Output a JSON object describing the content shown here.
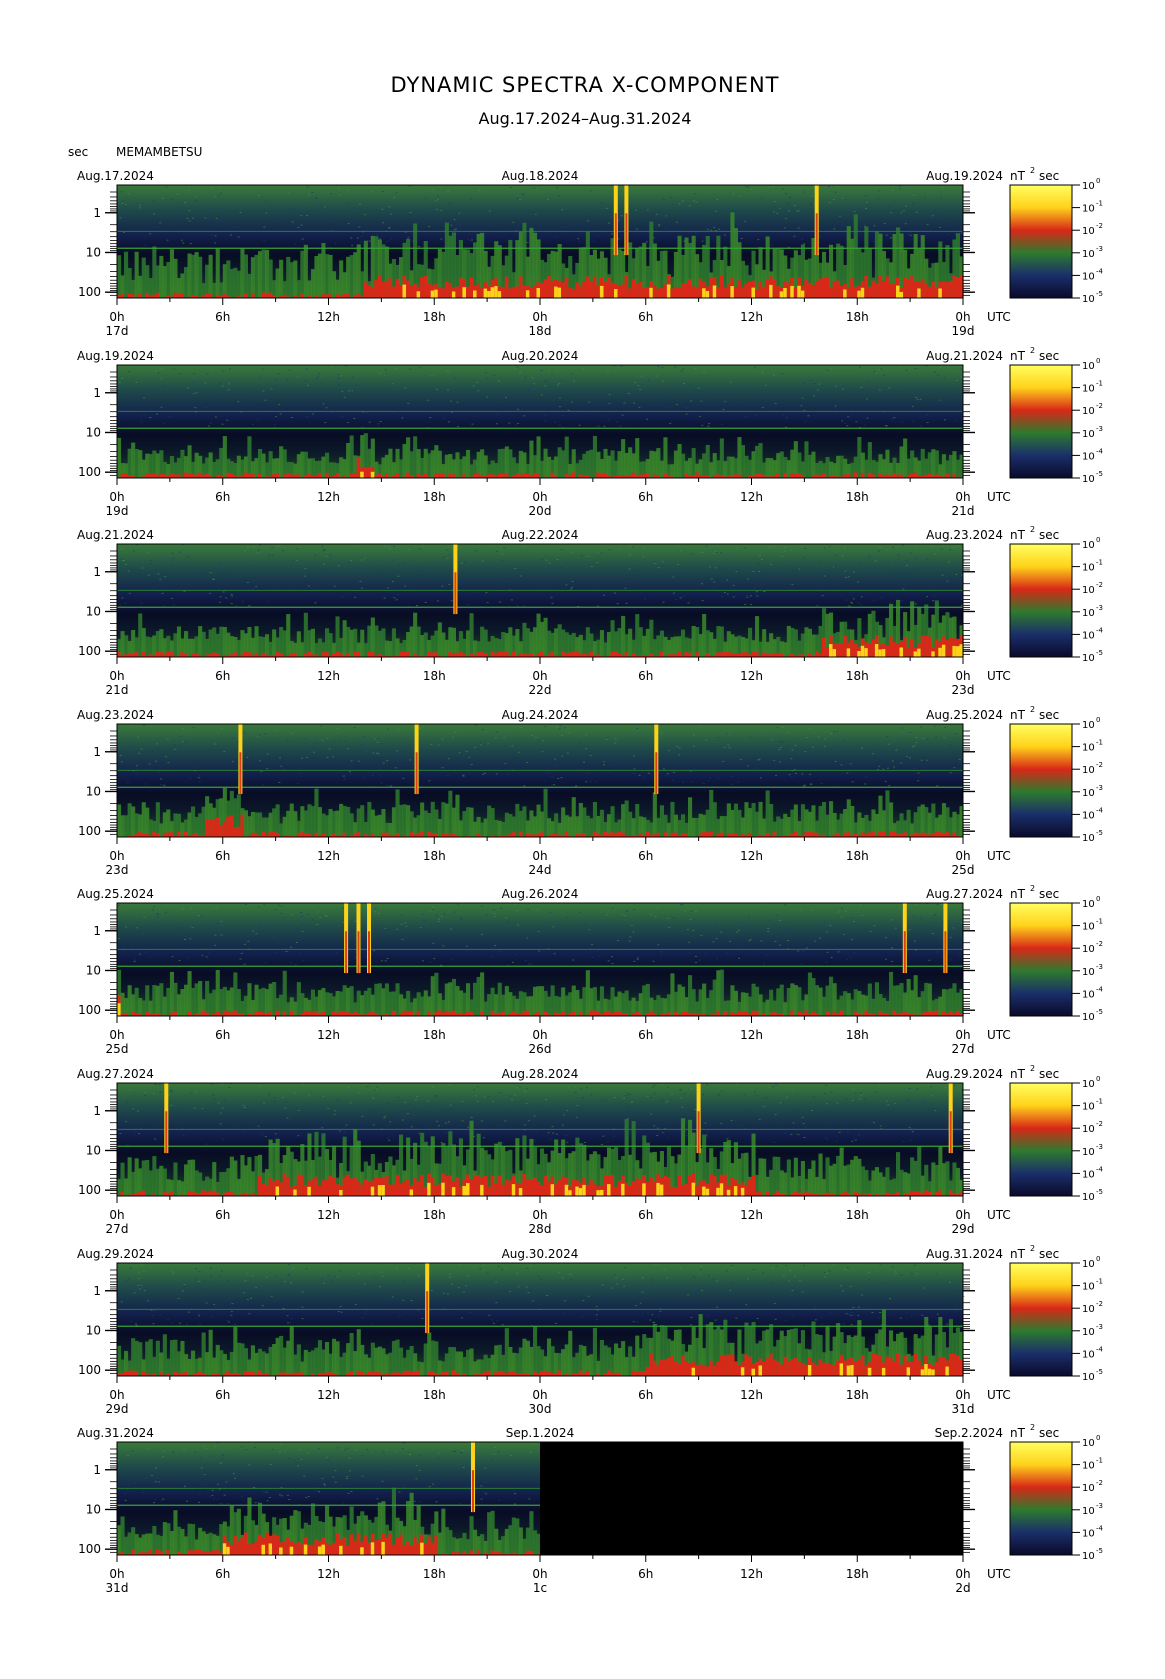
{
  "title": "DYNAMIC SPECTRA X-COMPONENT",
  "subtitle": "Aug.17.2024–Aug.31.2024",
  "unit_sec": "sec",
  "station": "MEMAMBETSU",
  "colorbar_unit": "nT",
  "colorbar_unit_exp": "2",
  "colorbar_unit_sec": "sec",
  "utc_label": "UTC",
  "colormap": [
    "#0a0a2a",
    "#1a2f6a",
    "#2e7a2e",
    "#d82818",
    "#ffd21a",
    "#ffff60"
  ],
  "chart_data": {
    "type": "heatmap",
    "period_yaxis": {
      "scale": "log",
      "ticks": [
        1,
        10,
        100
      ],
      "tick_labels": [
        "1",
        "10",
        "100"
      ],
      "label": "sec"
    },
    "colorbar": {
      "scale": "log",
      "range": [
        1e-05,
        1
      ],
      "tick_exponents": [
        "0",
        "-1",
        "-2",
        "-3",
        "-4",
        "-5"
      ],
      "unit": "nT² sec"
    },
    "x_tick_labels": [
      "0h",
      "6h",
      "12h",
      "18h",
      "0h",
      "6h",
      "12h",
      "18h",
      "0h"
    ],
    "panels": [
      {
        "left_date": "Aug.17.2024",
        "mid_date": "Aug.18.2024",
        "right_date": "Aug.19.2024",
        "days": [
          "17d",
          "18d",
          "19d"
        ],
        "spikes_hour": [
          28.3,
          28.9,
          39.7
        ],
        "activity": 0.9,
        "hot_start": 14,
        "hot_end": 48,
        "data_end_hour": 48
      },
      {
        "left_date": "Aug.19.2024",
        "mid_date": "Aug.20.2024",
        "right_date": "Aug.21.2024",
        "days": [
          "19d",
          "20d",
          "21d"
        ],
        "spikes_hour": [],
        "activity": 0.4,
        "hot_start": 13.5,
        "hot_end": 14.5,
        "data_end_hour": 48
      },
      {
        "left_date": "Aug.21.2024",
        "mid_date": "Aug.22.2024",
        "right_date": "Aug.23.2024",
        "days": [
          "21d",
          "22d",
          "23d"
        ],
        "spikes_hour": [
          19.2
        ],
        "activity": 0.45,
        "hot_start": 40,
        "hot_end": 48,
        "data_end_hour": 48
      },
      {
        "left_date": "Aug.23.2024",
        "mid_date": "Aug.24.2024",
        "right_date": "Aug.25.2024",
        "days": [
          "23d",
          "24d",
          "25d"
        ],
        "spikes_hour": [
          7.0,
          17.0,
          30.6
        ],
        "activity": 0.55,
        "hot_start": 5,
        "hot_end": 7,
        "data_end_hour": 48
      },
      {
        "left_date": "Aug.25.2024",
        "mid_date": "Aug.26.2024",
        "right_date": "Aug.27.2024",
        "days": [
          "25d",
          "26d",
          "27d"
        ],
        "spikes_hour": [
          13.0,
          13.7,
          14.3,
          44.7,
          47.0
        ],
        "activity": 0.5,
        "hot_start": 0,
        "hot_end": 0,
        "data_end_hour": 48
      },
      {
        "left_date": "Aug.27.2024",
        "mid_date": "Aug.28.2024",
        "right_date": "Aug.29.2024",
        "days": [
          "27d",
          "28d",
          "29d"
        ],
        "spikes_hour": [
          2.8,
          33.0,
          47.3
        ],
        "activity": 0.7,
        "hot_start": 8,
        "hot_end": 36,
        "data_end_hour": 48
      },
      {
        "left_date": "Aug.29.2024",
        "mid_date": "Aug.30.2024",
        "right_date": "Aug.31.2024",
        "days": [
          "29d",
          "30d",
          "31d"
        ],
        "spikes_hour": [
          17.6
        ],
        "activity": 0.6,
        "hot_start": 30,
        "hot_end": 48,
        "data_end_hour": 48
      },
      {
        "left_date": "Aug.31.2024",
        "mid_date": "Sep.1.2024",
        "right_date": "Sep.2.2024",
        "days": [
          "31d",
          "1c",
          "2d"
        ],
        "spikes_hour": [
          20.2
        ],
        "activity": 0.5,
        "hot_start": 6,
        "hot_end": 18,
        "data_end_hour": 24
      }
    ]
  }
}
